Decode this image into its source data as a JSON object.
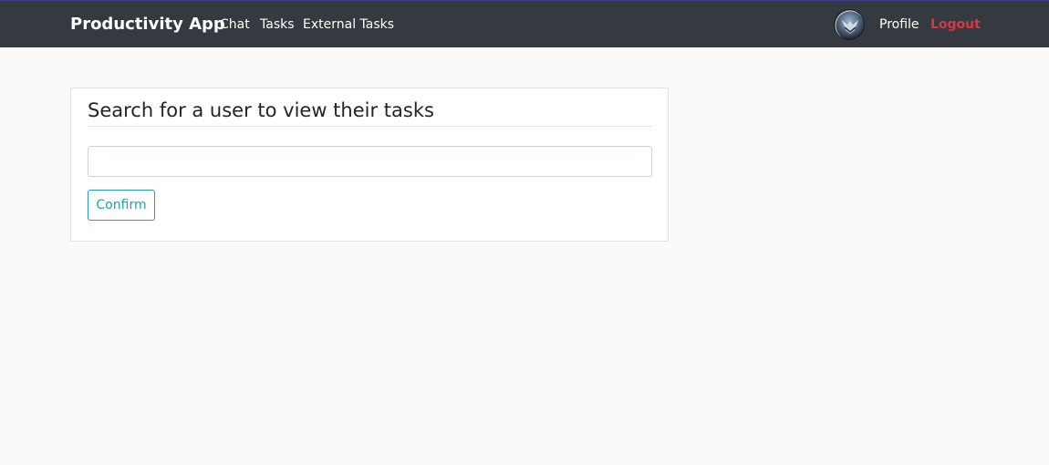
{
  "navbar": {
    "brand": "Productivity App",
    "links": {
      "chat": "Chat",
      "tasks": "Tasks",
      "external_tasks": "External Tasks",
      "profile": "Profile",
      "logout": "Logout"
    },
    "avatar_icon": "user-avatar"
  },
  "colors": {
    "navbar_bg": "#343a40",
    "logout": "#dc3545",
    "accent": "#17a2b8",
    "page_bg": "#fafafa"
  },
  "search_card": {
    "title": "Search for a user to view their tasks",
    "input_value": "",
    "input_placeholder": "",
    "confirm_label": "Confirm"
  }
}
